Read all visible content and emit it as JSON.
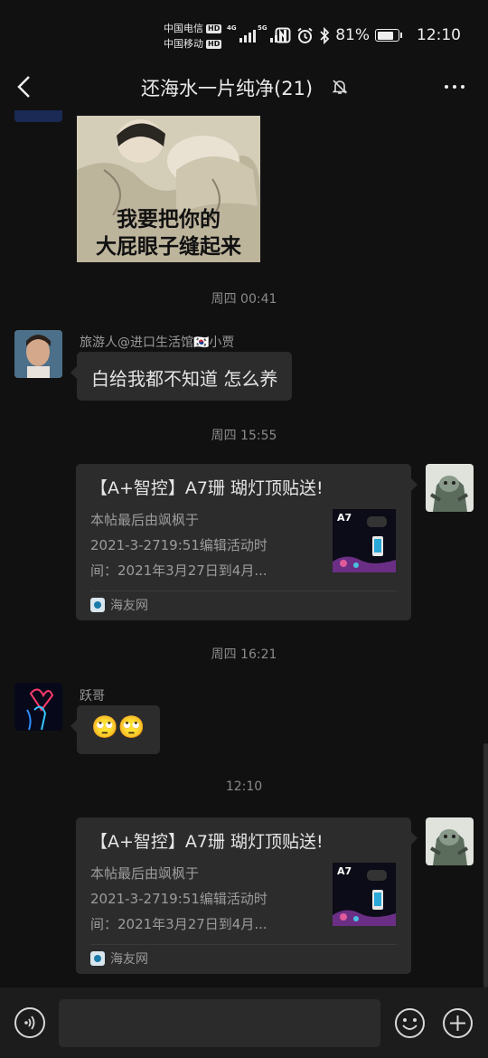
{
  "status_bar": {
    "carrier_1": "中国电信",
    "carrier_2": "中国移动",
    "hd_badge": "HD",
    "net_1": "4G",
    "net_2": "5G",
    "battery_text": "81%",
    "battery_level": 0.81,
    "time": "12:10"
  },
  "header": {
    "title": "还海水一片纯净(21)",
    "icons": [
      "back-arrow-icon",
      "bell-muted-icon",
      "more-dots-icon"
    ]
  },
  "messages": {
    "meme": {
      "caption_line1": "我要把你的",
      "caption_line2": "大屁眼子缝起来"
    },
    "time_1": "周四 00:41",
    "msg_1": {
      "sender": "旅游人@进口生活馆🇰🇷小贾",
      "text": "白给我都不知道 怎么养"
    },
    "time_2": "周四 15:55",
    "card_1": {
      "title": "【A+智控】A7珊 瑚灯顶贴送!",
      "desc_line1": "本帖最后由飒枫于",
      "desc_line2": "2021-3-2719:51编辑活动时",
      "desc_line3": "间：2021年3月27日到4月...",
      "thumb_label": "A7",
      "source": "海友网"
    },
    "time_3": "周四 16:21",
    "msg_2": {
      "sender": "跃哥",
      "text": "🙄🙄"
    },
    "time_4": "12:10",
    "card_2": {
      "title": "【A+智控】A7珊 瑚灯顶贴送!",
      "desc_line1": "本帖最后由飒枫于",
      "desc_line2": "2021-3-2719:51编辑活动时",
      "desc_line3": "间：2021年3月27日到4月...",
      "thumb_label": "A7",
      "source": "海友网"
    }
  },
  "input_bar": {
    "placeholder": "",
    "icons": [
      "voice-icon",
      "emoji-icon",
      "plus-icon"
    ]
  }
}
